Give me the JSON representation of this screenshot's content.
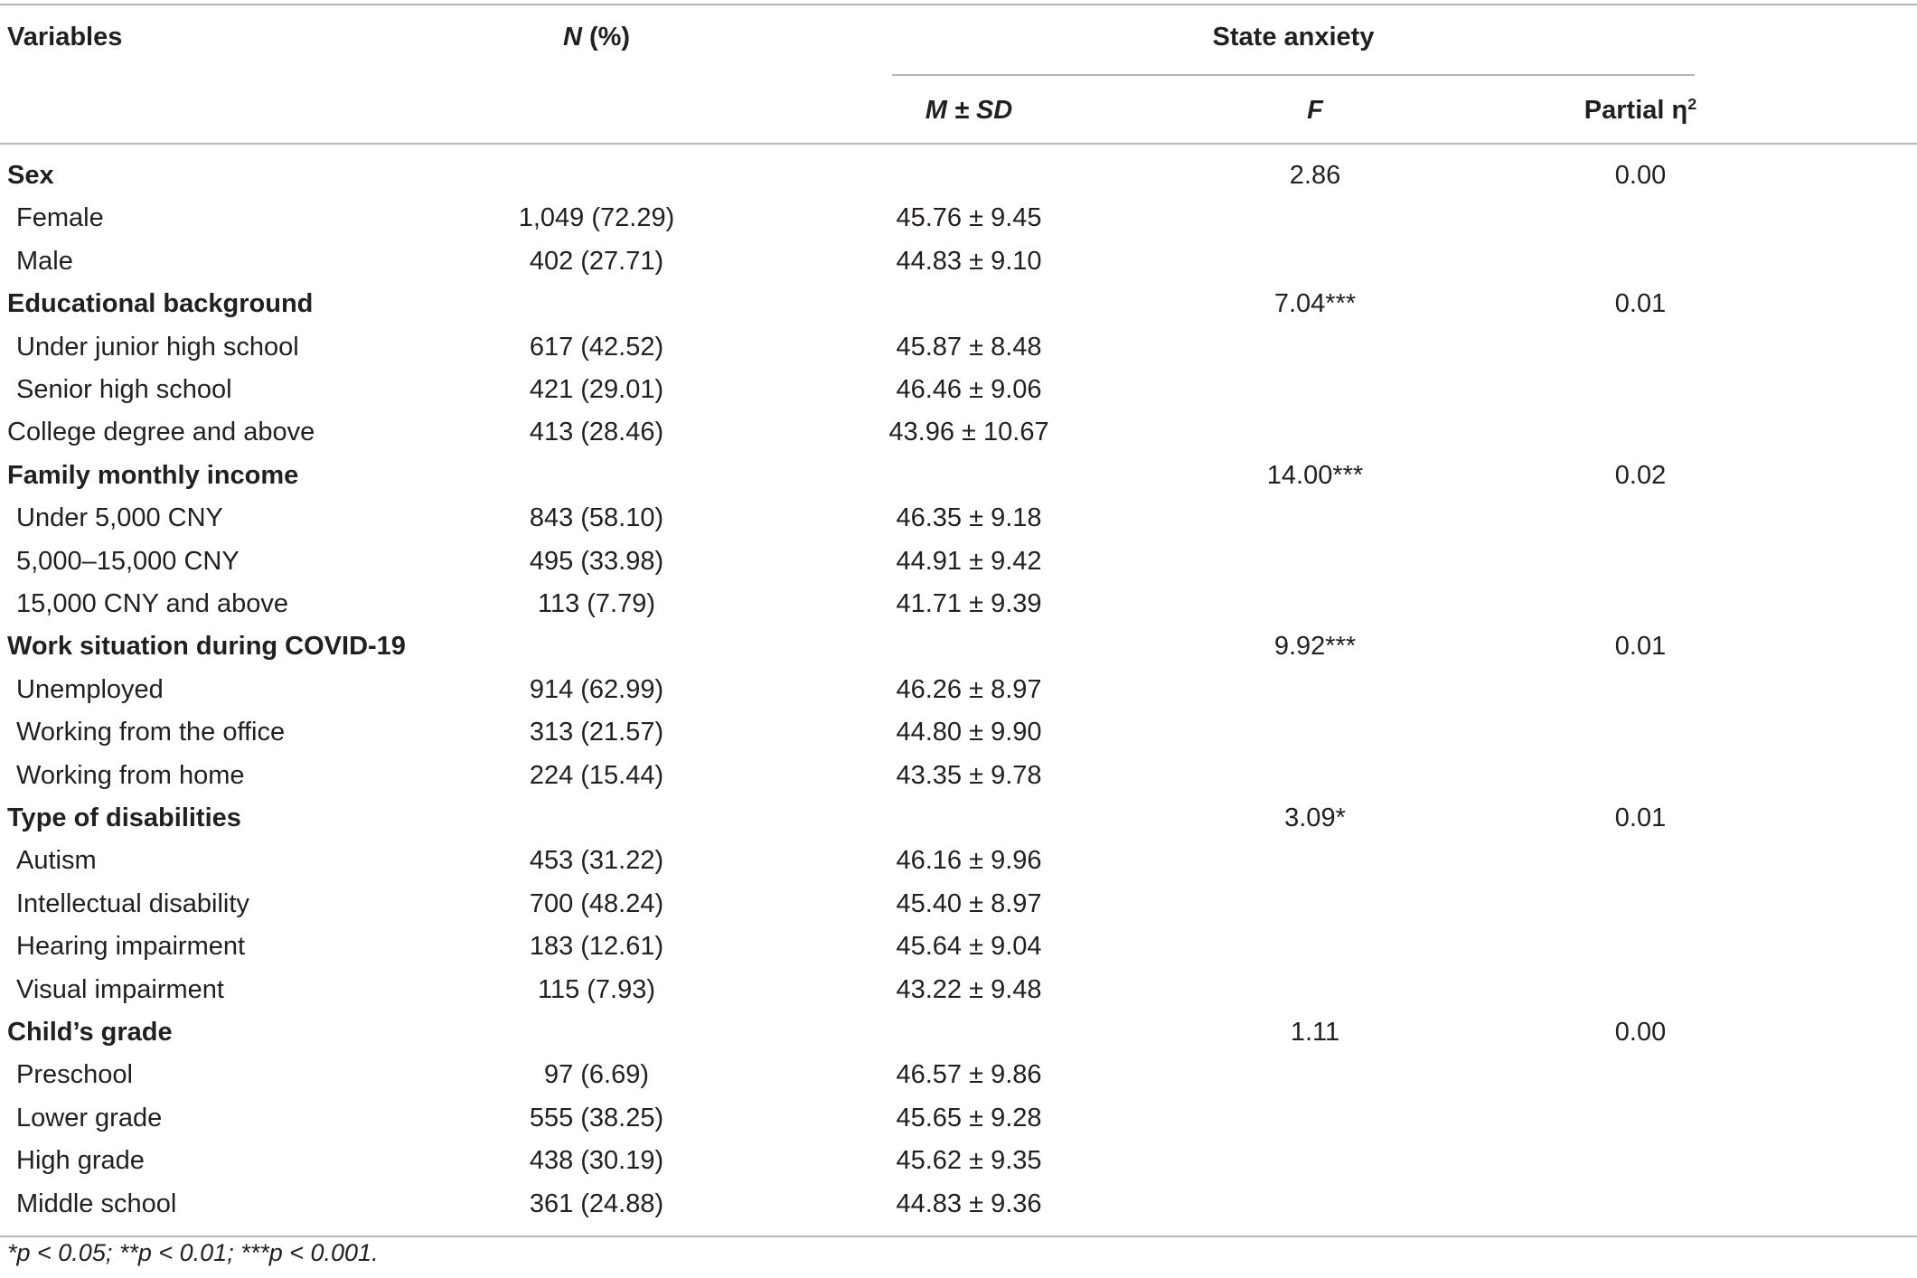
{
  "header": {
    "variables": "Variables",
    "n_percent_italic": "N",
    "n_percent_rest": " (%)",
    "state_anxiety": "State anxiety",
    "m_sd": "M ± SD",
    "f": "F",
    "partial_eta_label": "Partial η",
    "partial_eta_sup": "2"
  },
  "rows": [
    {
      "label": "Sex",
      "n": "",
      "msd": "",
      "f": "2.86",
      "eta": "0.00",
      "group": true
    },
    {
      "label": "Female",
      "n": "1,049 (72.29)",
      "msd": "45.76 ± 9.45",
      "f": "",
      "eta": ""
    },
    {
      "label": "Male",
      "n": "402 (27.71)",
      "msd": "44.83 ± 9.10",
      "f": "",
      "eta": ""
    },
    {
      "label": "Educational background",
      "n": "",
      "msd": "",
      "f": "7.04***",
      "eta": "0.01",
      "group": true
    },
    {
      "label": "Under junior high school",
      "n": "617 (42.52)",
      "msd": "45.87 ± 8.48",
      "f": "",
      "eta": ""
    },
    {
      "label": "Senior high school",
      "n": "421 (29.01)",
      "msd": "46.46 ± 9.06",
      "f": "",
      "eta": ""
    },
    {
      "label": "College degree and above",
      "n": "413 (28.46)",
      "msd": "43.96 ± 10.67",
      "f": "",
      "eta": "",
      "flush": true
    },
    {
      "label": "Family monthly income",
      "n": "",
      "msd": "",
      "f": "14.00***",
      "eta": "0.02",
      "group": true
    },
    {
      "label": "Under 5,000 CNY",
      "n": "843 (58.10)",
      "msd": "46.35 ± 9.18",
      "f": "",
      "eta": ""
    },
    {
      "label": "5,000–15,000 CNY",
      "n": "495 (33.98)",
      "msd": "44.91 ± 9.42",
      "f": "",
      "eta": ""
    },
    {
      "label": "15,000 CNY and above",
      "n": "113 (7.79)",
      "msd": "41.71 ± 9.39",
      "f": "",
      "eta": ""
    },
    {
      "label": "Work situation during COVID-19",
      "n": "",
      "msd": "",
      "f": "9.92***",
      "eta": "0.01",
      "group": true
    },
    {
      "label": "Unemployed",
      "n": "914 (62.99)",
      "msd": "46.26 ± 8.97",
      "f": "",
      "eta": ""
    },
    {
      "label": "Working from the office",
      "n": "313 (21.57)",
      "msd": "44.80 ± 9.90",
      "f": "",
      "eta": ""
    },
    {
      "label": "Working from home",
      "n": "224 (15.44)",
      "msd": "43.35 ± 9.78",
      "f": "",
      "eta": ""
    },
    {
      "label": "Type of disabilities",
      "n": "",
      "msd": "",
      "f": "3.09*",
      "eta": "0.01",
      "group": true
    },
    {
      "label": "Autism",
      "n": "453 (31.22)",
      "msd": "46.16 ± 9.96",
      "f": "",
      "eta": ""
    },
    {
      "label": "Intellectual disability",
      "n": "700 (48.24)",
      "msd": "45.40 ± 8.97",
      "f": "",
      "eta": ""
    },
    {
      "label": "Hearing impairment",
      "n": "183 (12.61)",
      "msd": "45.64 ± 9.04",
      "f": "",
      "eta": ""
    },
    {
      "label": "Visual impairment",
      "n": "115 (7.93)",
      "msd": "43.22 ± 9.48",
      "f": "",
      "eta": ""
    },
    {
      "label": "Child’s grade",
      "n": "",
      "msd": "",
      "f": "1.11",
      "eta": "0.00",
      "group": true
    },
    {
      "label": "Preschool",
      "n": "97 (6.69)",
      "msd": "46.57 ± 9.86",
      "f": "",
      "eta": ""
    },
    {
      "label": "Lower grade",
      "n": "555 (38.25)",
      "msd": "45.65 ± 9.28",
      "f": "",
      "eta": ""
    },
    {
      "label": "High grade",
      "n": "438 (30.19)",
      "msd": "45.62 ± 9.35",
      "f": "",
      "eta": ""
    },
    {
      "label": "Middle school",
      "n": "361 (24.88)",
      "msd": "44.83 ± 9.36",
      "f": "",
      "eta": ""
    }
  ],
  "footnote": "*p < 0.05; **p < 0.01; ***p < 0.001."
}
